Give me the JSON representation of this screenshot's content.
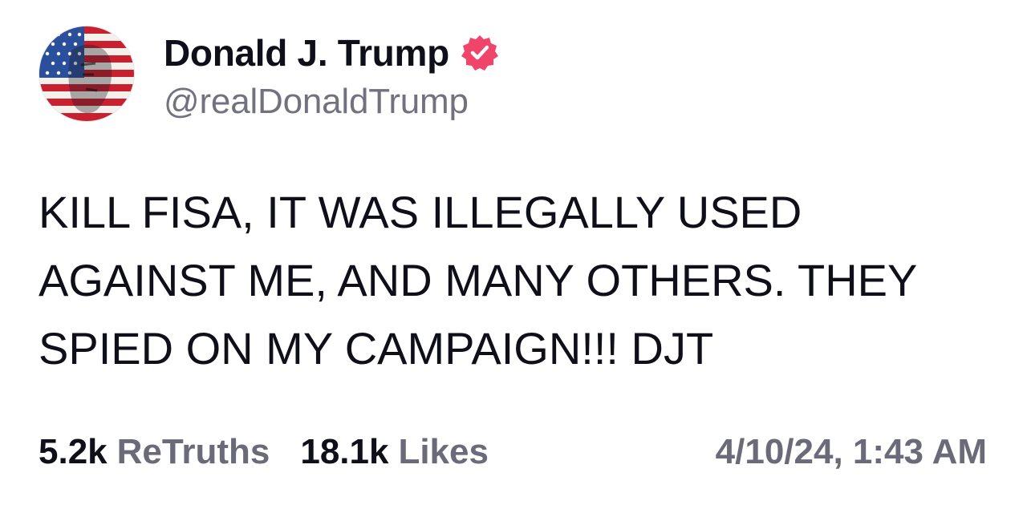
{
  "author": {
    "display_name": "Donald J. Trump",
    "handle": "@realDonaldTrump",
    "avatar_icon": "flag-portrait-avatar",
    "verified_icon": "verified-badge-icon",
    "verified_color": "#f0446a"
  },
  "post": {
    "text": "KILL FISA, IT WAS ILLEGALLY USED\nAGAINST ME, AND MANY OTHERS. THEY\nSPIED ON MY CAMPAIGN!!! DJT"
  },
  "stats": {
    "retruths_count": "5.2k",
    "retruths_label": "ReTruths",
    "likes_count": "18.1k",
    "likes_label": "Likes"
  },
  "timestamp": "4/10/24, 1:43 AM",
  "colors": {
    "text_primary": "#0f0f1a",
    "text_secondary": "#6a6a78",
    "background": "#ffffff"
  }
}
